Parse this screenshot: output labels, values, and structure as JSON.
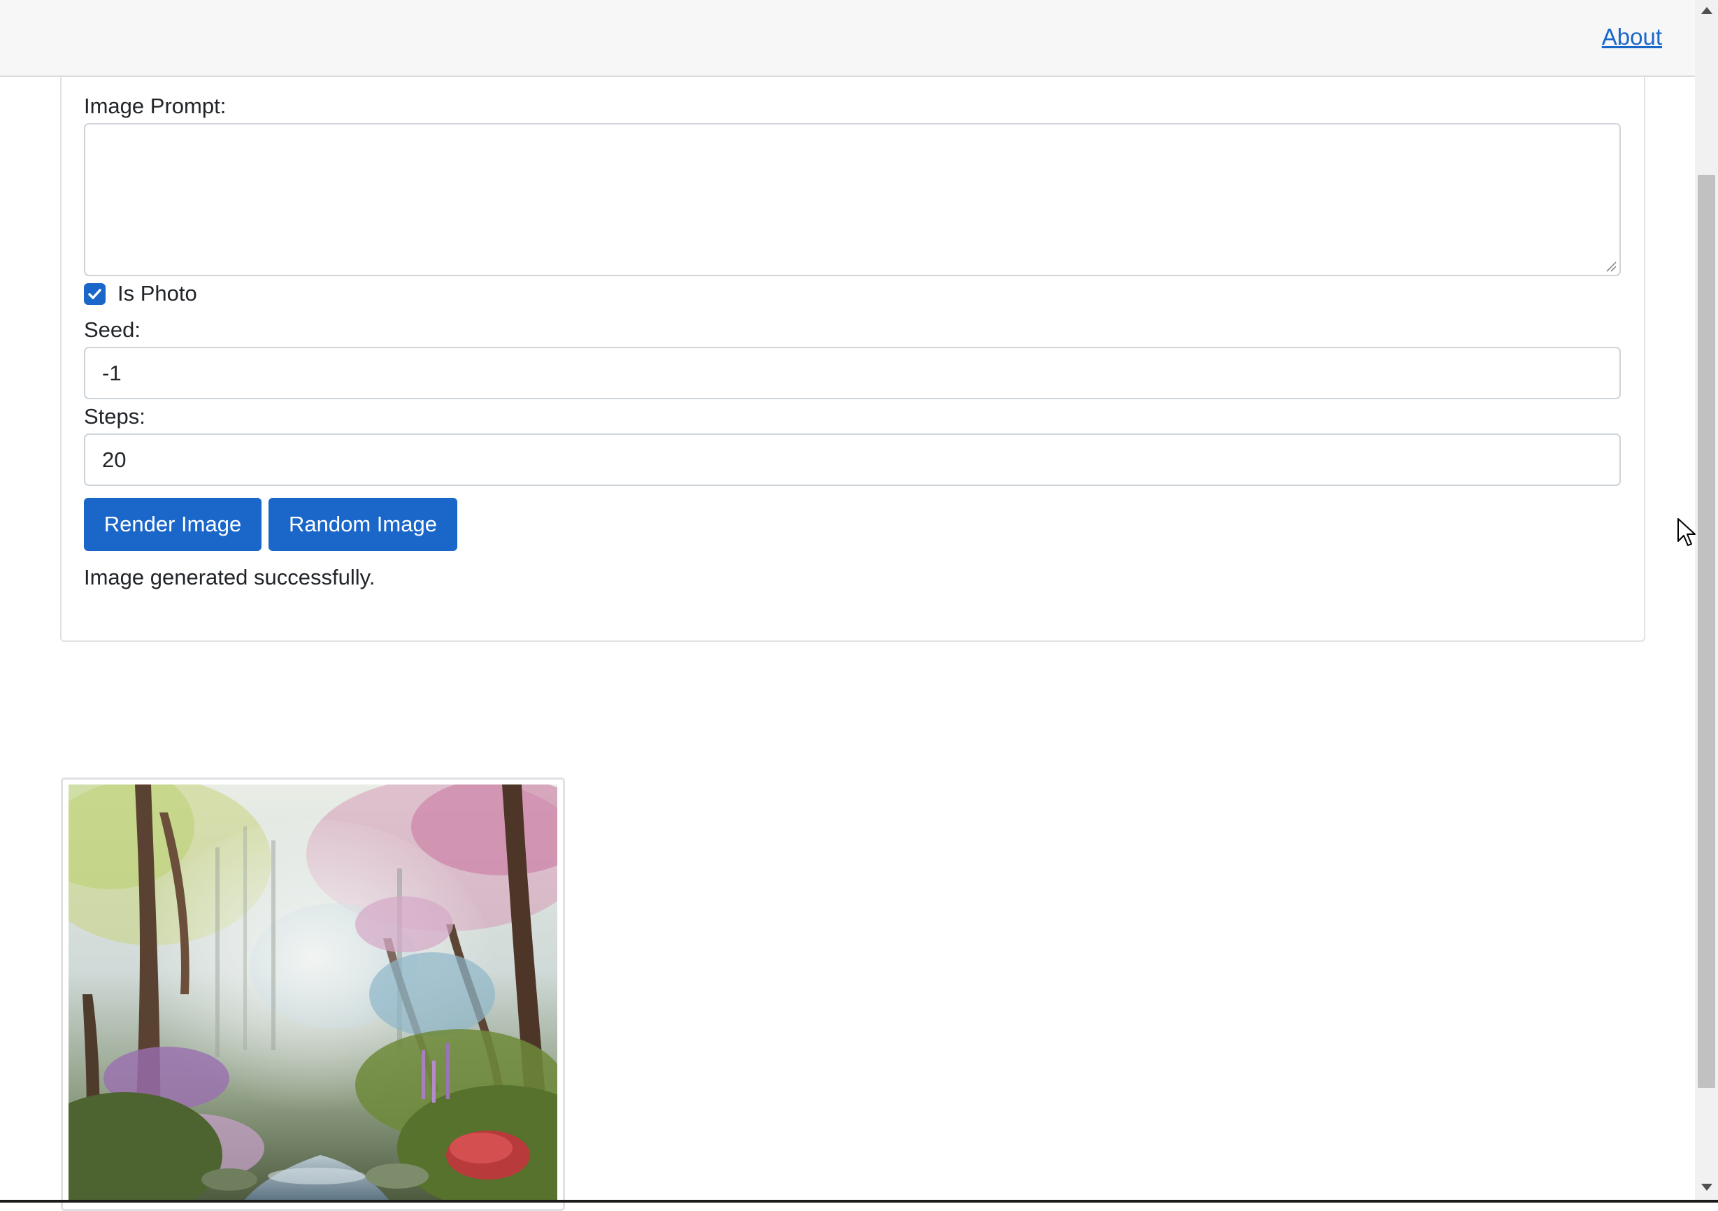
{
  "header": {
    "about_label": "About"
  },
  "form": {
    "prompt_label": "Image Prompt:",
    "prompt_value": "",
    "is_photo_label": "Is Photo",
    "is_photo_checked": true,
    "seed_label": "Seed:",
    "seed_value": "-1",
    "steps_label": "Steps:",
    "steps_value": "20",
    "render_button_label": "Render Image",
    "random_button_label": "Random Image",
    "status_message": "Image generated successfully."
  },
  "colors": {
    "accent": "#1a67c9",
    "topbar_bg": "#f7f7f7"
  }
}
